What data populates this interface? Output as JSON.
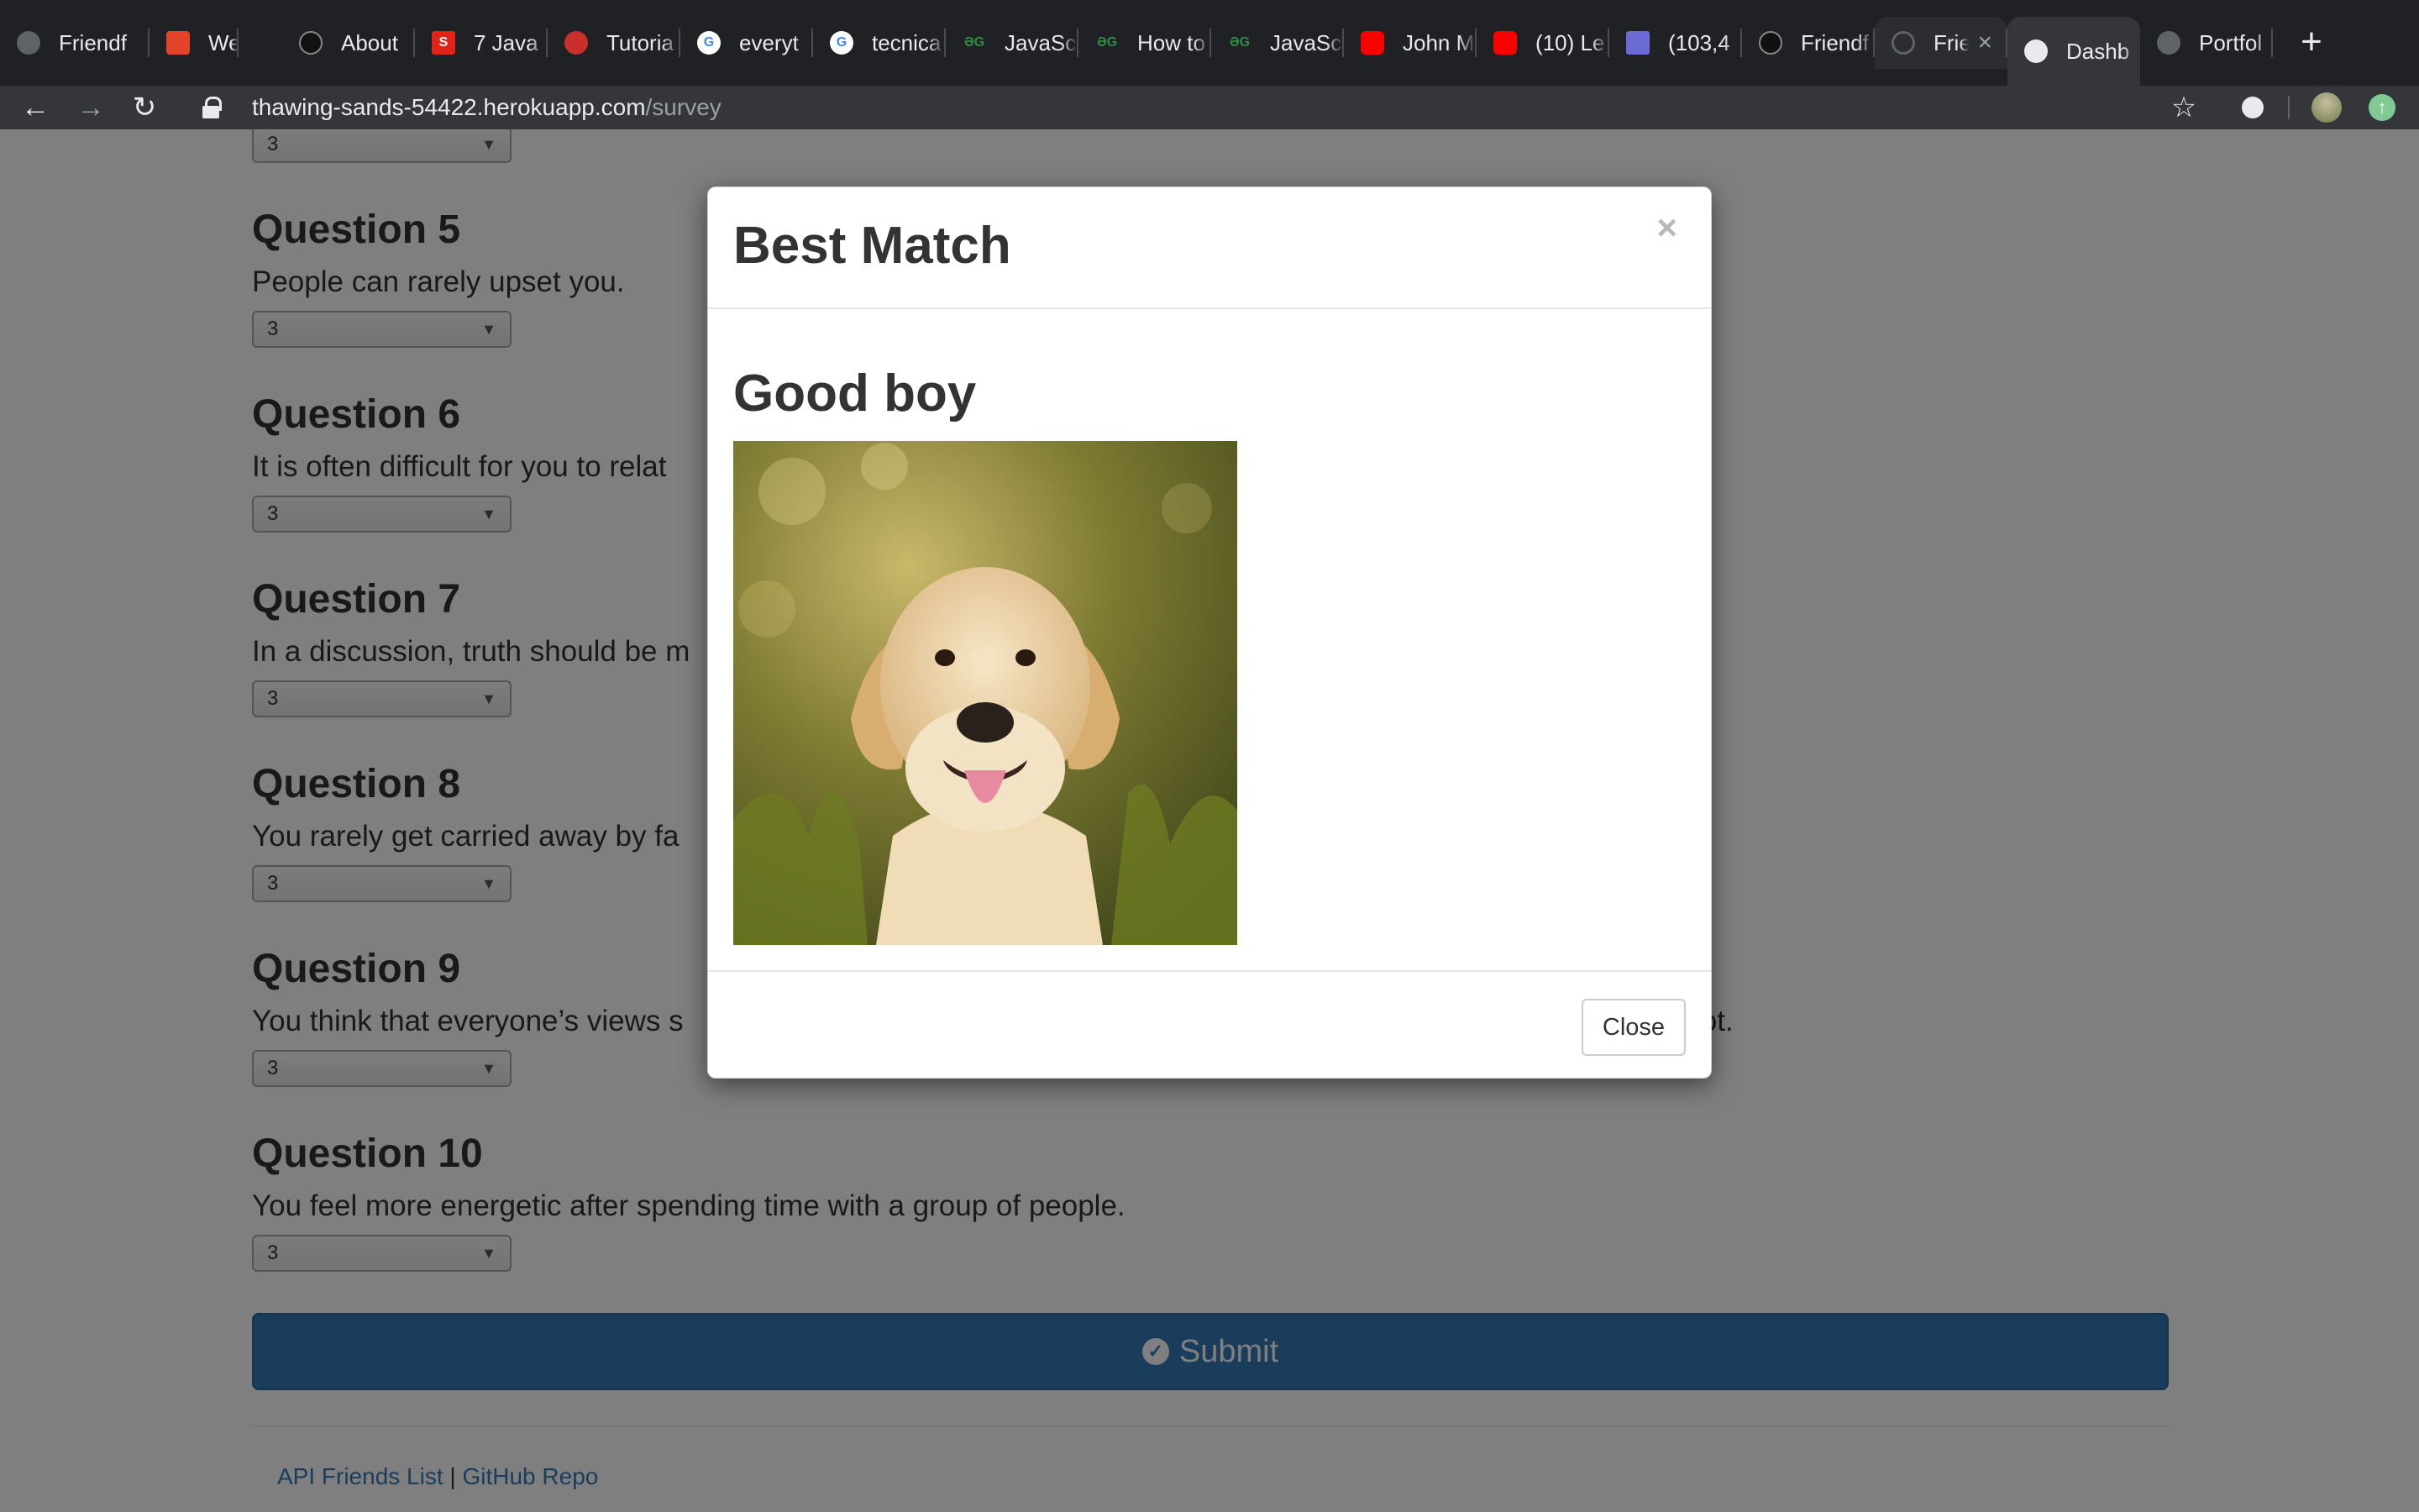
{
  "browser": {
    "tabs": [
      {
        "title": "Friendf",
        "icon": "globe-icon"
      },
      {
        "title": "Week-",
        "icon": "gitlab-icon"
      },
      {
        "title": "About",
        "icon": "github-icon"
      },
      {
        "title": "7 Java",
        "icon": "site-s-icon"
      },
      {
        "title": "Tutoria",
        "icon": "site-icon"
      },
      {
        "title": "everyt",
        "icon": "google-icon"
      },
      {
        "title": "tecnica",
        "icon": "google-icon"
      },
      {
        "title": "JavaSc",
        "icon": "geeks-icon"
      },
      {
        "title": "How to",
        "icon": "geeks-icon"
      },
      {
        "title": "JavaSc",
        "icon": "geeks-icon"
      },
      {
        "title": "John M",
        "icon": "youtube-icon"
      },
      {
        "title": "(10) Le",
        "icon": "youtube-icon"
      },
      {
        "title": "(103,4",
        "icon": "mail-icon"
      },
      {
        "title": "Friendf",
        "icon": "github-icon"
      },
      {
        "title": "Frie",
        "icon": "loading-icon",
        "active": true
      },
      {
        "title": "Dashb",
        "icon": "globe-icon"
      },
      {
        "title": "Portfol",
        "icon": "globe-icon"
      }
    ],
    "url_host": "thawing-sands-54422.herokuapp.com",
    "url_path": "/survey"
  },
  "survey": {
    "top_select_value": "3",
    "questions": [
      {
        "title": "Question 5",
        "text": "People can rarely upset you.",
        "value": "3"
      },
      {
        "title": "Question 6",
        "text": "It is often difficult for you to relat",
        "value": "3"
      },
      {
        "title": "Question 7",
        "text": "In a discussion, truth should be m",
        "value": "3"
      },
      {
        "title": "Question 8",
        "text": "You rarely get carried away by fa",
        "value": "3"
      },
      {
        "title": "Question 9",
        "text": "You think that everyone’s views s",
        "text_tail": "r not.",
        "value": "3"
      },
      {
        "title": "Question 10",
        "text": "You feel more energetic after spending time with a group of people.",
        "value": "3"
      }
    ],
    "submit_label": "Submit",
    "footer": {
      "api_link": "API Friends List",
      "separator": "|",
      "repo_link": "GitHub Repo"
    }
  },
  "modal": {
    "title": "Best Match",
    "close_x": "×",
    "match_name": "Good boy",
    "close_label": "Close"
  }
}
